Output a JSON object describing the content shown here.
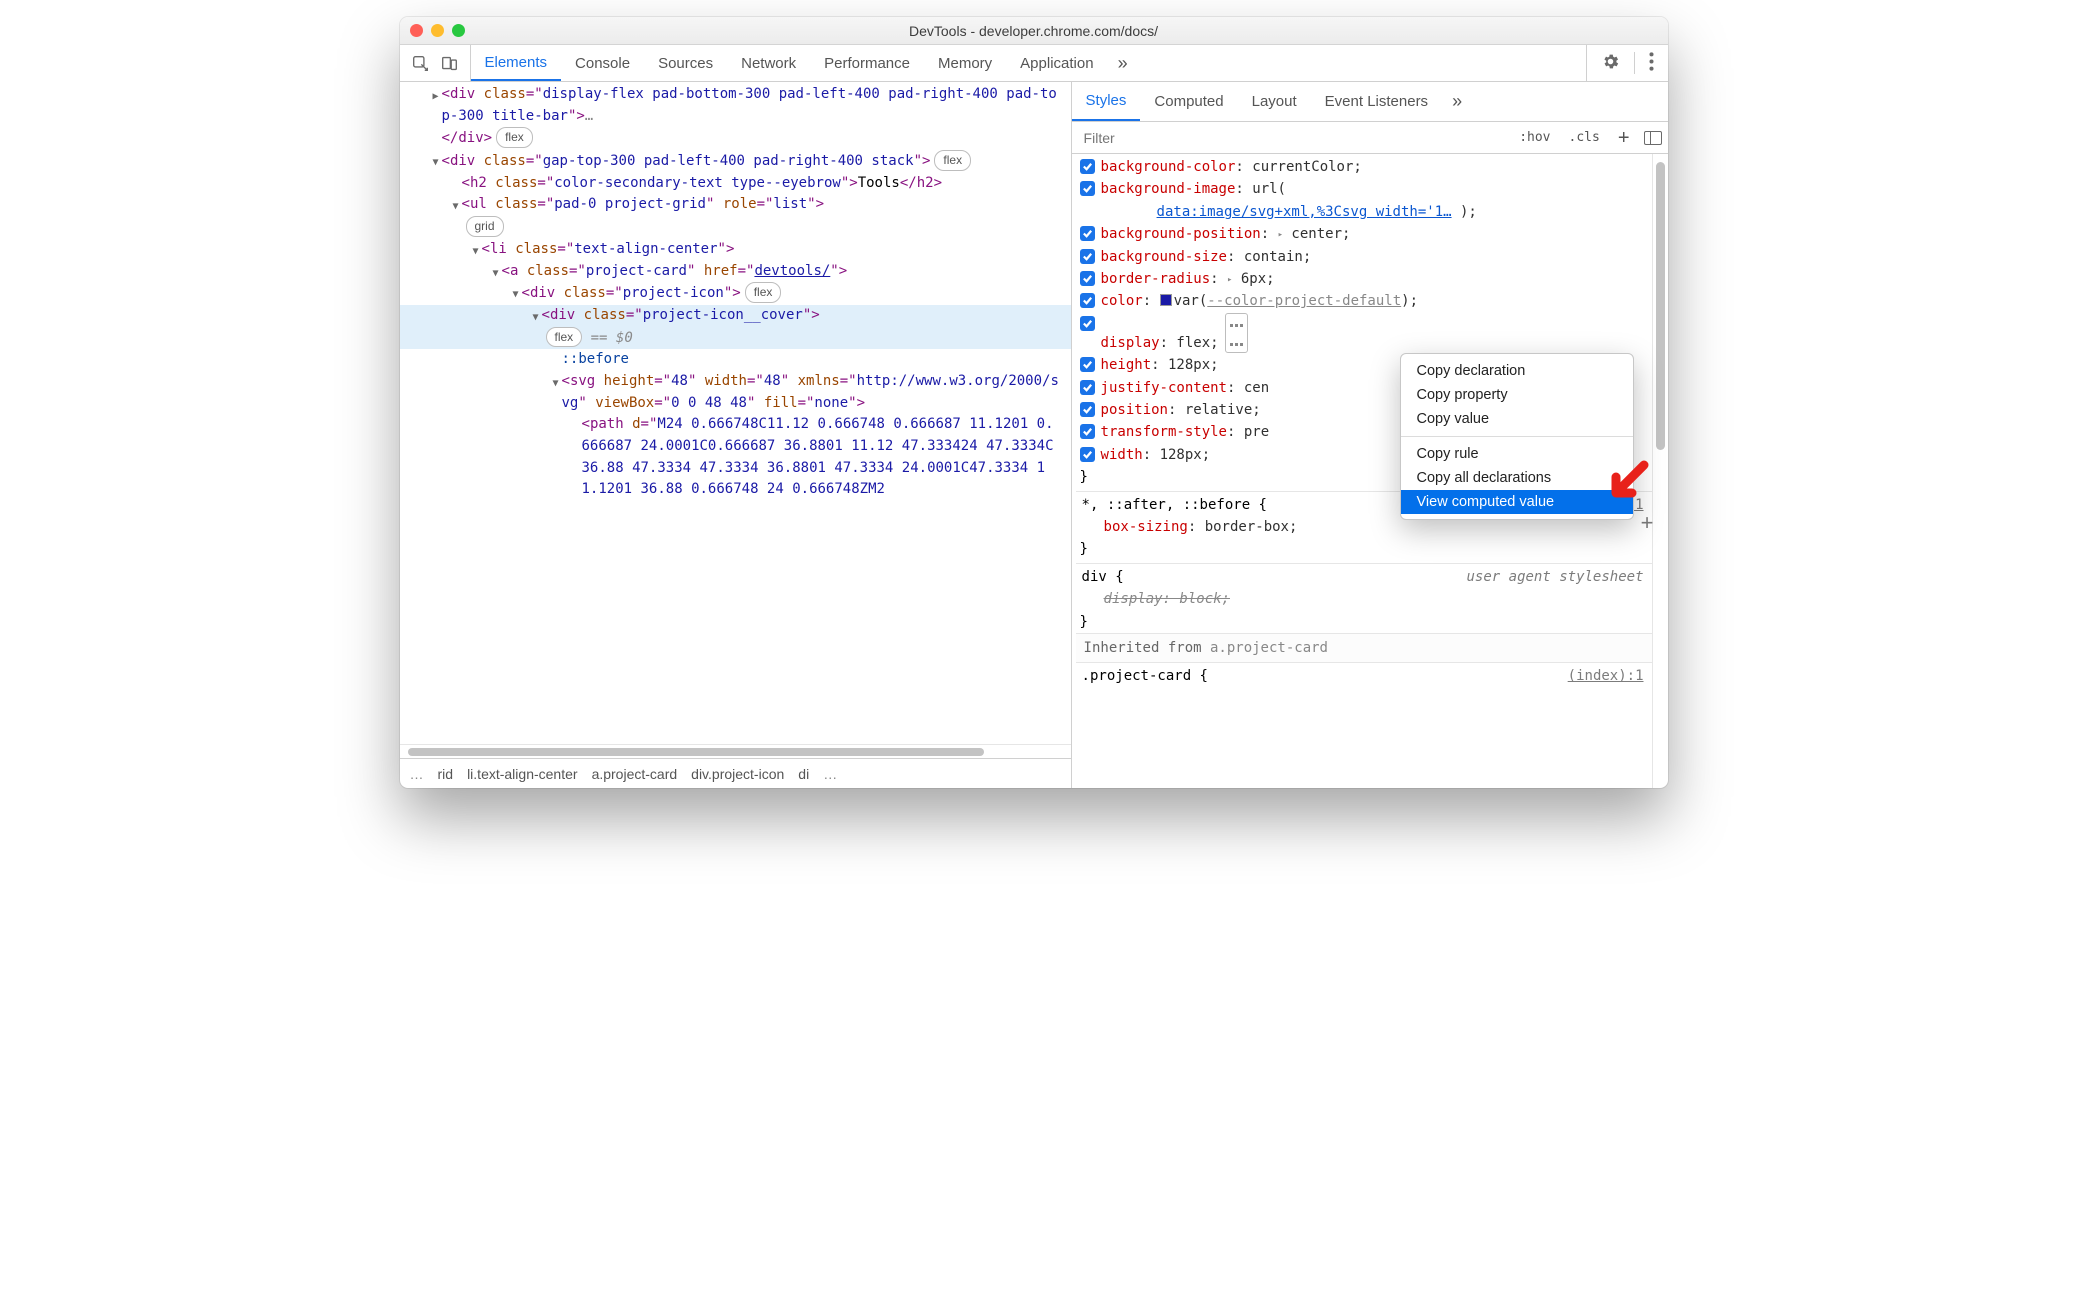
{
  "title": "DevTools - developer.chrome.com/docs/",
  "toolbar": {
    "tabs": [
      "Elements",
      "Console",
      "Sources",
      "Network",
      "Performance",
      "Memory",
      "Application"
    ],
    "activeTab": "Elements",
    "more": "»"
  },
  "tree": {
    "row1": "<div class=\"display-flex pad-bottom-300 pad-left-400 pad-right-400 pad-top-300 title-bar\">…",
    "row1_close": "</div>",
    "pill_flex": "flex",
    "row2": "<div class=\"gap-top-300 pad-left-400 pad-right-400 stack\">",
    "row3_open": "<h2 class=\"color-secondary-text type--eyebrow\">",
    "row3_text": "Tools",
    "row3_close": "</h2>",
    "row4": "<ul class=\"pad-0 project-grid\" role=\"list\">",
    "pill_grid": "grid",
    "row5": "<li class=\"text-align-center\">",
    "row6": "<a class=\"project-card\" href=\"devtools/\">",
    "row7": "<div class=\"project-icon\">",
    "row8": "<div class=\"project-icon__cover\">",
    "eq0": "== $0",
    "row9": "::before",
    "row10": "<svg height=\"48\" width=\"48\" xmlns=\"http://www.w3.org/2000/svg\" viewBox=\"0 0 48 48\" fill=\"none\">",
    "row11": "<path d=\"M24 0.666748C11.12 0.666748 0.666687 11.1201 0.666687 24.0001C0.666687 36.8801 11.12 47.333424 47.3334C36.88 47.3334 47.3334 36.8801 47.3334 24.0001C47.3334 11.1201 36.88 0.666748 24 0.666748ZM2"
  },
  "crumbs": {
    "more_l": "…",
    "items": [
      "rid",
      "li.text-align-center",
      "a.project-card",
      "div.project-icon",
      "di"
    ],
    "more_r": "…"
  },
  "right": {
    "tabs": [
      "Styles",
      "Computed",
      "Layout",
      "Event Listeners"
    ],
    "activeTab": "Styles",
    "more": "»",
    "filter_placeholder": "Filter",
    "hov": ":hov",
    "cls": ".cls"
  },
  "decls": [
    {
      "prop": "background-color",
      "val": "currentColor;"
    },
    {
      "prop": "background-image",
      "val": "url(",
      "url": "data:image/svg+xml,%3Csvg width='1…",
      "tail": ");"
    },
    {
      "prop": "background-position",
      "val_pre": "▸",
      "val": "center;"
    },
    {
      "prop": "background-size",
      "val": "contain;"
    },
    {
      "prop": "border-radius",
      "val_pre": "▸",
      "val": "6px;"
    },
    {
      "prop": "color",
      "swatch": true,
      "varname": "--color-project-default",
      "tail": ");",
      "fn": "var("
    },
    {
      "prop": "display",
      "val": "flex;",
      "flexicon": true
    },
    {
      "prop": "height",
      "val": "128px;"
    },
    {
      "prop": "justify-content",
      "val": "cen"
    },
    {
      "prop": "position",
      "val": "relative;"
    },
    {
      "prop": "transform-style",
      "val": "pre"
    },
    {
      "prop": "width",
      "val": "128px;"
    }
  ],
  "brace_close": "}",
  "rule2": {
    "sel": "*, ::after, ::before {",
    "src": "(index):1",
    "prop": "box-sizing",
    "val": "border-box;"
  },
  "rule3": {
    "sel": "div {",
    "src": "user agent stylesheet",
    "decl": "display: block;"
  },
  "inherit": {
    "label": "Inherited from ",
    "sel": "a.project-card"
  },
  "rule4": {
    "sel": ".project-card {",
    "src": "(index):1"
  },
  "menu": {
    "items": [
      "Copy declaration",
      "Copy property",
      "Copy value",
      "Copy rule",
      "Copy all declarations",
      "View computed value"
    ],
    "selected": "View computed value"
  }
}
